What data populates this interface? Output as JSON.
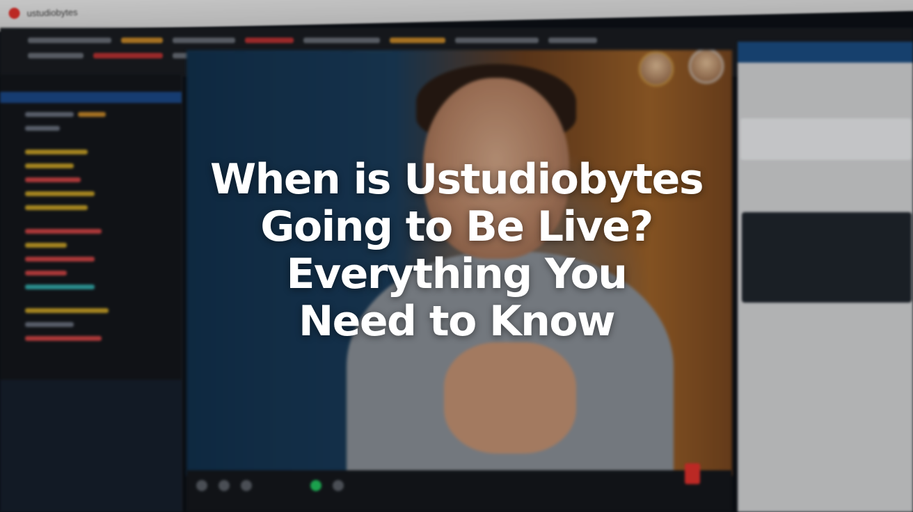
{
  "browser": {
    "tab_title": "ustudiobytes",
    "record_icon": "record-dot-icon"
  },
  "headline": {
    "lines": [
      "When is Ustudiobytes",
      "Going to Be Live?",
      "Everything You",
      "Need to Know"
    ]
  },
  "colors": {
    "accent_blue": "#1c4a8a",
    "live_red": "#e5322d",
    "go_live_green": "#22c55e"
  },
  "video": {
    "participants": [
      "participant-avatar-1",
      "participant-avatar-2"
    ]
  }
}
